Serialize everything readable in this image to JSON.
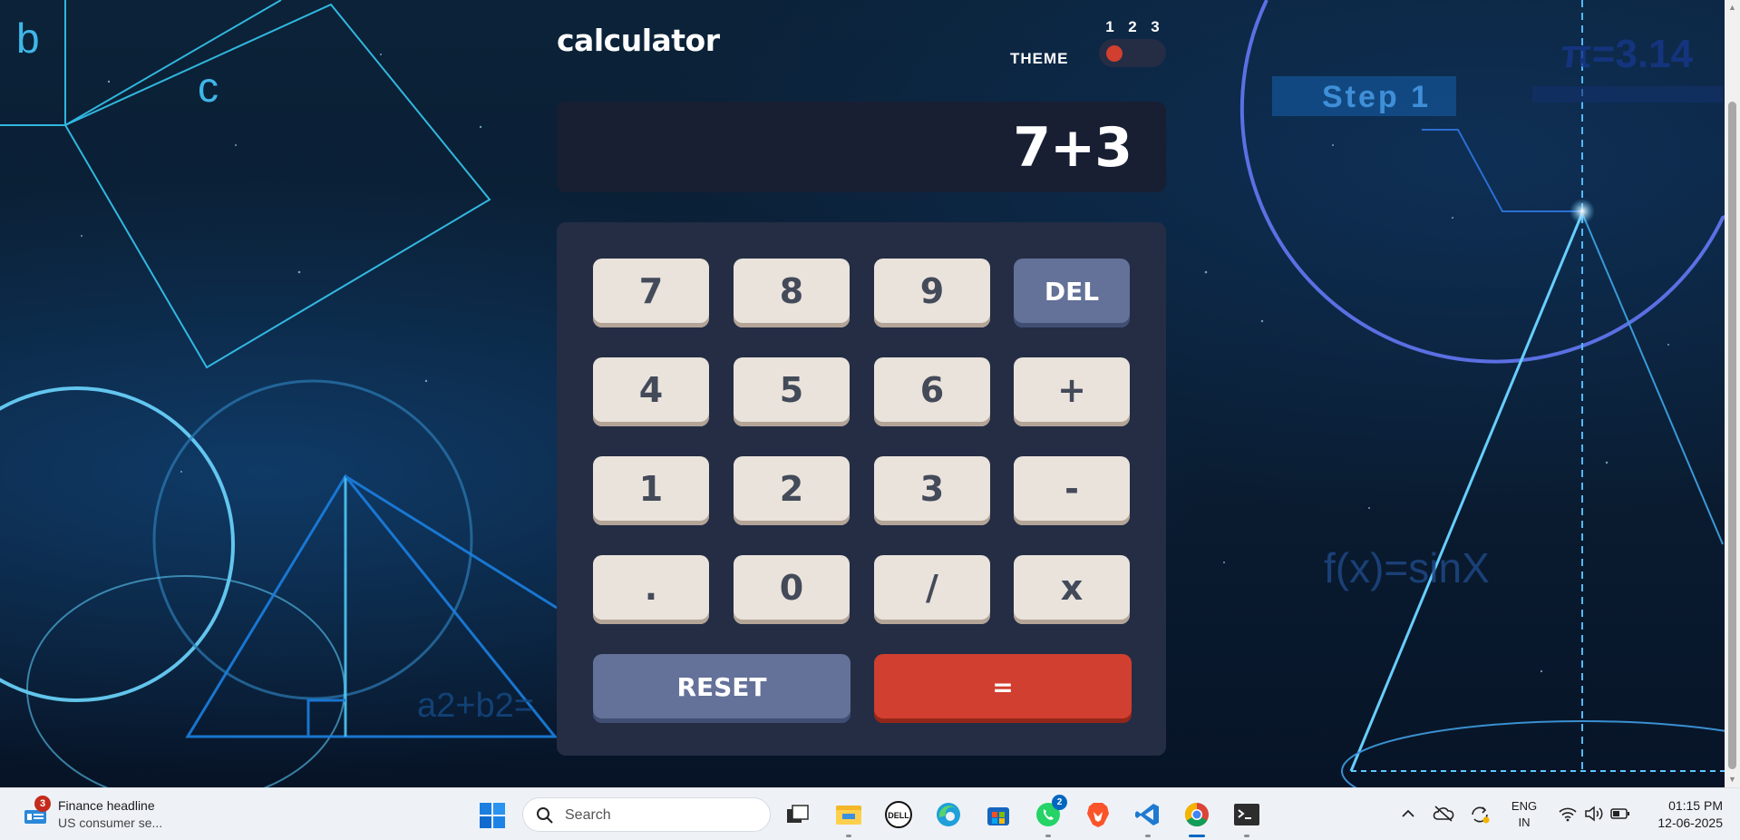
{
  "calculator": {
    "title": "calculator",
    "theme_label": "THEME",
    "theme_options": [
      "1",
      "2",
      "3"
    ],
    "theme_selected": 1,
    "display_value": "7+3",
    "keys": {
      "k7": "7",
      "k8": "8",
      "k9": "9",
      "del": "DEL",
      "k4": "4",
      "k5": "5",
      "k6": "6",
      "plus": "+",
      "k1": "1",
      "k2": "2",
      "k3": "3",
      "minus": "-",
      "dot": ".",
      "k0": "0",
      "divide": "/",
      "multiply": "x",
      "reset": "RESET",
      "equals": "="
    },
    "colors": {
      "keypad_bg": "#242d44",
      "display_bg": "#181f33",
      "key_bg": "#eae3dc",
      "key_text": "#434a59",
      "accent_blue": "#647198",
      "accent_red": "#d03f2f"
    }
  },
  "background_text": {
    "b": "b",
    "c": "c",
    "step": "Step 1",
    "pi": "π=3.14",
    "fx": "f(x)=sinX",
    "pythag": "a2+b2="
  },
  "taskbar": {
    "news_badge": "3",
    "news_title": "Finance headline",
    "news_subtitle": "US consumer se...",
    "search_placeholder": "Search",
    "whatsapp_badge": "2",
    "lang_line1": "ENG",
    "lang_line2": "IN",
    "time": "01:15 PM",
    "date": "12-06-2025",
    "apps": [
      "start-icon",
      "task-view-icon",
      "file-explorer-icon",
      "dell-icon",
      "edge-icon",
      "store-icon",
      "whatsapp-icon",
      "brave-icon",
      "vscode-icon",
      "chrome-icon",
      "terminal-icon"
    ]
  }
}
